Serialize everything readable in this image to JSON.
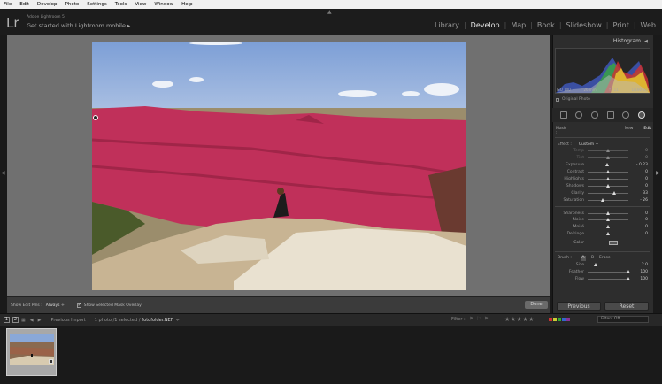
{
  "menubar": {
    "items": [
      "File",
      "Edit",
      "Develop",
      "Photo",
      "Settings",
      "Tools",
      "View",
      "Window",
      "Help"
    ]
  },
  "identity": {
    "logo": "Lr",
    "app_name": "Adobe Lightroom 5",
    "subtitle": "Get started with Lightroom mobile ▸"
  },
  "modules": {
    "items": [
      {
        "label": "Library",
        "active": false
      },
      {
        "label": "Develop",
        "active": true
      },
      {
        "label": "Map",
        "active": false
      },
      {
        "label": "Book",
        "active": false
      },
      {
        "label": "Slideshow",
        "active": false
      },
      {
        "label": "Print",
        "active": false
      },
      {
        "label": "Web",
        "active": false
      }
    ]
  },
  "toolbar": {
    "show_edit_pins_label": "Show Edit Pins :",
    "show_edit_pins_value": "Always ÷",
    "overlay_label": "Show Selected Mask Overlay",
    "overlay_check": "✓",
    "done_label": "Done"
  },
  "histogram": {
    "title": "Histogram",
    "info": [
      "ISO 100",
      "26 mm",
      "f / 11",
      "1/160 sec"
    ],
    "original_photo_label": "Original Photo"
  },
  "mask": {
    "label": "Mask :",
    "new_label": "New",
    "edit_label": "Edit"
  },
  "effect": {
    "label": "Effect :",
    "value": "Custom ÷"
  },
  "sliders": [
    {
      "label": "Temp",
      "value": "0",
      "pos": 0.5,
      "dim": true
    },
    {
      "label": "Tint",
      "value": "0",
      "pos": 0.5,
      "dim": true
    },
    {
      "label": "Exposure",
      "value": "- 0.23",
      "pos": 0.47,
      "dim": false
    },
    {
      "label": "Contrast",
      "value": "0",
      "pos": 0.5,
      "dim": false
    },
    {
      "label": "Highlights",
      "value": "0",
      "pos": 0.5,
      "dim": false
    },
    {
      "label": "Shadows",
      "value": "0",
      "pos": 0.5,
      "dim": false
    },
    {
      "label": "Clarity",
      "value": "33",
      "pos": 0.66,
      "dim": false
    },
    {
      "label": "Saturation",
      "value": "- 26",
      "pos": 0.37,
      "dim": false
    },
    {
      "label": "Sharpness",
      "value": "0",
      "pos": 0.5,
      "dim": false
    },
    {
      "label": "Noise",
      "value": "0",
      "pos": 0.5,
      "dim": false
    },
    {
      "label": "Moiré",
      "value": "0",
      "pos": 0.5,
      "dim": false
    },
    {
      "label": "Defringe",
      "value": "0",
      "pos": 0.5,
      "dim": false
    }
  ],
  "color_label": "Color",
  "brush": {
    "label": "Brush :",
    "a": "A",
    "b": "B",
    "erase": "Erase",
    "sliders": [
      {
        "label": "Size",
        "value": "2.0",
        "pos": 0.2
      },
      {
        "label": "Feather",
        "value": "100",
        "pos": 1.0
      },
      {
        "label": "Flow",
        "value": "100",
        "pos": 1.0
      }
    ]
  },
  "panel_buttons": {
    "previous": "Previous",
    "reset": "Reset"
  },
  "filmstrip_bar": {
    "box1": "1",
    "box2": "2",
    "previous_import": "Previous Import",
    "count": "1 photo /1 selected /",
    "filename": "fotofolder.NEF",
    "filename_arrow": "÷",
    "filter_label": "Filter :",
    "stars": "★★★★★",
    "filters_off": "Filters Off"
  },
  "colors": {
    "accent_mask": "#c0305a",
    "panel_bg": "#2d2d2d",
    "canvas_bg": "#707070"
  }
}
